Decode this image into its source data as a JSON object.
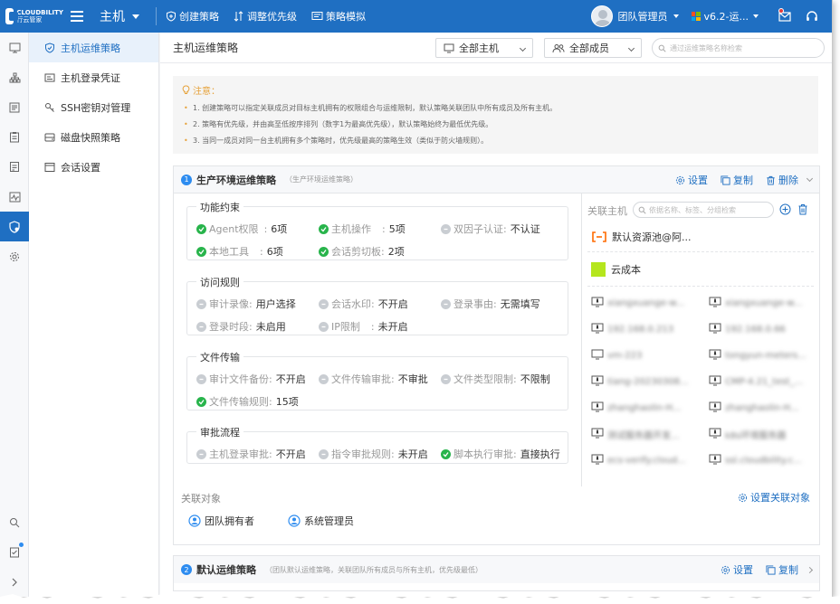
{
  "topbar": {
    "logo_text": "CLOUDBILITY",
    "logo_sub": "行云管家",
    "module": "主机",
    "actions": [
      {
        "label": "创建策略",
        "icon": "shield-plus-icon"
      },
      {
        "label": "调整优先级",
        "icon": "sort-icon"
      },
      {
        "label": "策略模拟",
        "icon": "monitor-icon"
      }
    ],
    "team": "团队管理员",
    "version": "v6.2-运..."
  },
  "subnav": {
    "items": [
      {
        "label": "主机运维策略",
        "icon": "shield-icon",
        "active": true
      },
      {
        "label": "主机登录凭证",
        "icon": "credential-icon"
      },
      {
        "label": "SSH密钥对管理",
        "icon": "key-icon"
      },
      {
        "label": "磁盘快照策略",
        "icon": "disk-icon"
      },
      {
        "label": "会话设置",
        "icon": "window-icon"
      }
    ]
  },
  "main": {
    "title": "主机运维策略",
    "host_filter": "全部主机",
    "member_filter": "全部成员",
    "search_placeholder": "通过运维策略名称检索"
  },
  "notice": {
    "title": "注意：",
    "lines": [
      "1. 创建策略可以指定关联成员对目标主机拥有的权限组合与运维限制，默认策略关联团队中所有成员及所有主机。",
      "2. 策略有优先级，并由高至低按序排列（数字1为最高优先级），默认策略始终为最低优先级。",
      "3. 当同一成员对同一台主机拥有多个策略时，优先级最高的策略生效（类似于防火墙规则）。"
    ]
  },
  "policy1": {
    "num": "1",
    "title": "生产环境运维策略",
    "subtitle": "（生产环境运维策略）",
    "settings": "设置",
    "copy": "复制",
    "delete": "删除",
    "groups": [
      {
        "title": "功能约束",
        "rules": [
          {
            "label": "Agent权限",
            "value": "6项",
            "on": true
          },
          {
            "label": "主机操作",
            "value": "5项",
            "on": true
          },
          {
            "label": "双因子认证",
            "value": "不认证",
            "on": false
          },
          {
            "label": "本地工具",
            "value": "6项",
            "on": true
          },
          {
            "label": "会话剪切板",
            "value": "2项",
            "on": true
          }
        ]
      },
      {
        "title": "访问规则",
        "rules": [
          {
            "label": "审计录像",
            "value": "用户选择",
            "on": false
          },
          {
            "label": "会话水印",
            "value": "不开启",
            "on": false
          },
          {
            "label": "登录事由",
            "value": "无需填写",
            "on": false
          },
          {
            "label": "登录时段",
            "value": "未启用",
            "on": false
          },
          {
            "label": "IP限制",
            "value": "未开启",
            "on": false
          }
        ]
      },
      {
        "title": "文件传输",
        "rules": [
          {
            "label": "审计文件备份",
            "value": "不开启",
            "on": false
          },
          {
            "label": "文件传输审批",
            "value": "不审批",
            "on": false
          },
          {
            "label": "文件类型限制",
            "value": "不限制",
            "on": false
          },
          {
            "label": "文件传输规则",
            "value": "15项",
            "on": true
          }
        ]
      },
      {
        "title": "审批流程",
        "rules": [
          {
            "label": "主机登录审批",
            "value": "不开启",
            "on": false
          },
          {
            "label": "指令审批规则",
            "value": "未开启",
            "on": false
          },
          {
            "label": "脚本执行审批",
            "value": "直接执行",
            "on": true
          }
        ]
      }
    ],
    "related_hosts": {
      "label": "关联主机",
      "search_placeholder": "依据名称、标签、分组检索",
      "resource_pool": "默认资源池@阿...",
      "cost": "云成本",
      "hosts_left": [
        "xiangxuange-w...",
        "192.168.0.213",
        "vm-223",
        "tiang-20230308...",
        "zhanghaolin-H...",
        "测试服务器开发...",
        "ecs-verify.cloud..."
      ],
      "hosts_right": [
        "xiangxuange-w...",
        "192.168.0.66",
        "tongyun-meters...",
        "CMP-4.21_test_...",
        "zhanghaolin-H...",
        "k8s环境服务器",
        "ssl.cloudbility.c..."
      ]
    },
    "related_objects": {
      "label": "关联对象",
      "link": "设置关联对象",
      "items": [
        "团队拥有者",
        "系统管理员"
      ]
    }
  },
  "policy2": {
    "num": "2",
    "title": "默认运维策略",
    "subtitle": "（团队默认运维策略，关联团队所有成员与所有主机，优先级最低）",
    "settings": "设置",
    "copy": "复制"
  },
  "colors": {
    "primary": "#1f6fc2",
    "on": "#28b44b",
    "off": "#c9cdd2",
    "warning": "#e6a23c"
  }
}
